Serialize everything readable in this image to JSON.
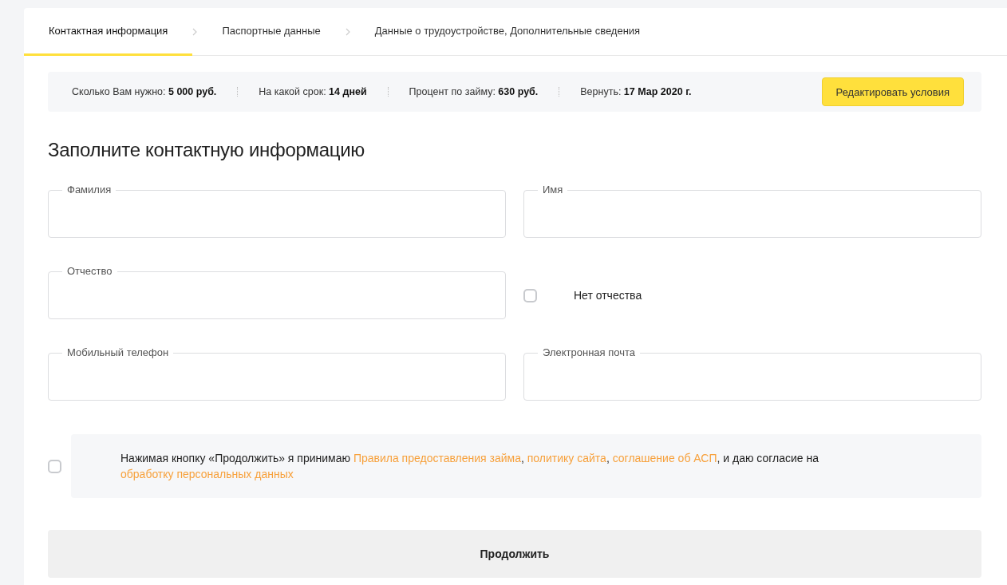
{
  "tabs": [
    {
      "label": "Контактная информация",
      "selected": true
    },
    {
      "label": "Паспортные данные",
      "selected": false
    },
    {
      "label": "Данные о трудоустройстве, Дополнительные сведения",
      "selected": false
    }
  ],
  "summary": {
    "items": [
      {
        "label": "Сколько Вам нужно:",
        "value": "5 000 руб."
      },
      {
        "label": "На какой срок:",
        "value": "14 дней"
      },
      {
        "label": "Процент по займу:",
        "value": "630 руб."
      },
      {
        "label": "Вернуть:",
        "value": "17 Мар 2020 г."
      }
    ],
    "button": "Редактировать условия"
  },
  "heading": "Заполните контактную информацию",
  "fields": [
    {
      "kind": "field",
      "label": "Фамилия"
    },
    {
      "kind": "field",
      "label": "Имя"
    },
    {
      "kind": "field",
      "label": "Отчество"
    },
    {
      "kind": "checkbox",
      "label": "Нет отчества",
      "checked": false
    },
    {
      "kind": "field",
      "label": "Мобильный телефон"
    },
    {
      "kind": "field",
      "label": "Электронная почта"
    }
  ],
  "consent": {
    "checked": false,
    "parts": [
      {
        "kind": "text",
        "text": "Нажимая кнопку «Продолжить» я принимаю "
      },
      {
        "kind": "link",
        "text": "Правила предоставления займа"
      },
      {
        "kind": "text",
        "text": ", "
      },
      {
        "kind": "link",
        "text": "политику сайта"
      },
      {
        "kind": "text",
        "text": ", "
      },
      {
        "kind": "link",
        "text": "соглашение об АСП"
      },
      {
        "kind": "text",
        "text": ", и даю согласие на "
      },
      {
        "kind": "link",
        "text": "обработку персональных данных"
      }
    ]
  },
  "submit": "Продолжить"
}
